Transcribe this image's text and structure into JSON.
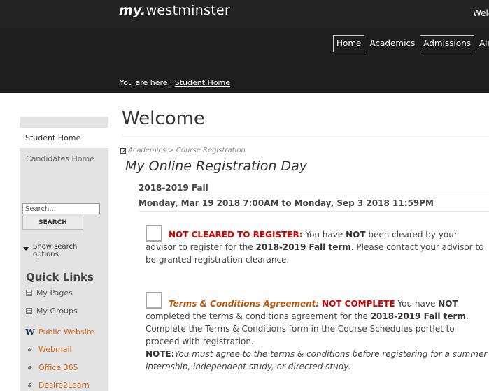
{
  "header": {
    "logo_prefix": "my.",
    "logo_name": "westminster",
    "welcome_text": "Welc",
    "nav": [
      "Home",
      "Academics",
      "Admissions",
      "Alumn"
    ],
    "breadcrumb_label": "You are here:",
    "breadcrumb_link": "Student Home"
  },
  "sidebar": {
    "active_item": "Student Home",
    "item": "Candidates Home",
    "search_placeholder": "Search...",
    "search_button": "SEARCH",
    "show_options": "Show search options",
    "quick_links_title": "Quick Links",
    "quick_links": [
      {
        "label": "My Pages",
        "icon": "page-icon"
      },
      {
        "label": "My Groups",
        "icon": "page-icon"
      },
      {
        "label": "Public Website",
        "icon": "w-icon"
      },
      {
        "label": "Webmail",
        "icon": "link-icon"
      },
      {
        "label": "Office 365",
        "icon": "link-icon"
      },
      {
        "label": "Desire2Learn",
        "icon": "link-icon"
      }
    ]
  },
  "main": {
    "title": "Welcome",
    "portlet_crumb": "Academics > Course Registration",
    "portlet_title": "My Online Registration Day",
    "term": "2018-2019 Fall",
    "dates": "Monday, Mar 19 2018 7:00AM to Monday, Sep 3 2018 11:59PM",
    "block1": {
      "heading": "NOT CLEARED TO REGISTER:",
      "t1": " You have ",
      "b1": "NOT",
      "t2": " been cleared by your advisor to register for the ",
      "b2": "2018-2019 Fall term",
      "t3": ". Please contact your advisor to be granted registration clearance."
    },
    "block2": {
      "heading": "Terms & Conditions Agreement:",
      "status": "NOT COMPLETE",
      "t1": " You have ",
      "b1": "NOT",
      "t2": " completed the terms & conditions agreement for the ",
      "b2": "2018-2019 Fall term",
      "t3": ". Complete the Terms & Conditions form in the Course Schedules portlet to proceed with registration.",
      "note_label": "NOTE:",
      "note_text": "You must agree to the terms & conditions before registering for a summer internship, independent study, or directed study."
    }
  }
}
